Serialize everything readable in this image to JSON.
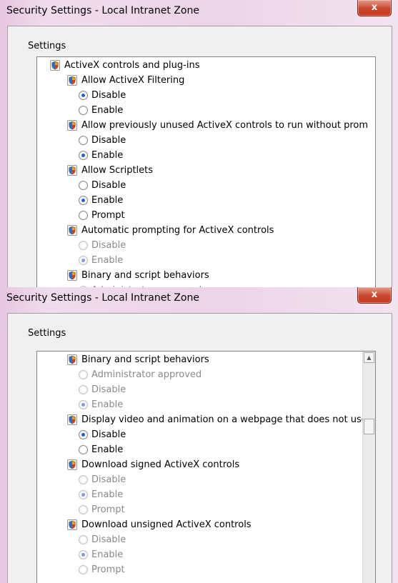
{
  "windows": [
    {
      "title": "Security Settings - Local Intranet Zone",
      "close_label": "x",
      "group_label": "Settings",
      "rows": [
        {
          "kind": "top",
          "text": "ActiveX controls and plug-ins"
        },
        {
          "kind": "header",
          "text": "Allow ActiveX Filtering"
        },
        {
          "kind": "option",
          "text": "Disable",
          "checked": true,
          "disabled": false
        },
        {
          "kind": "option",
          "text": "Enable",
          "checked": false,
          "disabled": false
        },
        {
          "kind": "header",
          "text": "Allow previously unused ActiveX controls to run without prom"
        },
        {
          "kind": "option",
          "text": "Disable",
          "checked": false,
          "disabled": false
        },
        {
          "kind": "option",
          "text": "Enable",
          "checked": true,
          "disabled": false
        },
        {
          "kind": "header",
          "text": "Allow Scriptlets"
        },
        {
          "kind": "option",
          "text": "Disable",
          "checked": false,
          "disabled": false
        },
        {
          "kind": "option",
          "text": "Enable",
          "checked": true,
          "disabled": false
        },
        {
          "kind": "option",
          "text": "Prompt",
          "checked": false,
          "disabled": false
        },
        {
          "kind": "header",
          "text": "Automatic prompting for ActiveX controls"
        },
        {
          "kind": "option",
          "text": "Disable",
          "checked": false,
          "disabled": true
        },
        {
          "kind": "option",
          "text": "Enable",
          "checked": true,
          "disabled": true
        },
        {
          "kind": "header",
          "text": "Binary and script behaviors"
        },
        {
          "kind": "option",
          "text": "Administrator approved",
          "checked": false,
          "disabled": true
        }
      ]
    },
    {
      "title": "Security Settings - Local Intranet Zone",
      "close_label": "x",
      "group_label": "Settings",
      "rows": [
        {
          "kind": "header",
          "text": "Binary and script behaviors"
        },
        {
          "kind": "option",
          "text": "Administrator approved",
          "checked": false,
          "disabled": true
        },
        {
          "kind": "option",
          "text": "Disable",
          "checked": false,
          "disabled": true
        },
        {
          "kind": "option",
          "text": "Enable",
          "checked": true,
          "disabled": true
        },
        {
          "kind": "header",
          "text": "Display video and animation on a webpage that does not use"
        },
        {
          "kind": "option",
          "text": "Disable",
          "checked": true,
          "disabled": false
        },
        {
          "kind": "option",
          "text": "Enable",
          "checked": false,
          "disabled": false
        },
        {
          "kind": "header",
          "text": "Download signed ActiveX controls"
        },
        {
          "kind": "option",
          "text": "Disable",
          "checked": false,
          "disabled": true
        },
        {
          "kind": "option",
          "text": "Enable",
          "checked": true,
          "disabled": true
        },
        {
          "kind": "option",
          "text": "Prompt",
          "checked": false,
          "disabled": true
        },
        {
          "kind": "header",
          "text": "Download unsigned ActiveX controls"
        },
        {
          "kind": "option",
          "text": "Disable",
          "checked": false,
          "disabled": true
        },
        {
          "kind": "option",
          "text": "Enable",
          "checked": true,
          "disabled": true
        },
        {
          "kind": "option",
          "text": "Prompt",
          "checked": false,
          "disabled": true
        }
      ],
      "scrollbar": {
        "up_arrow": "▲",
        "down_arrow": "▼"
      }
    }
  ]
}
